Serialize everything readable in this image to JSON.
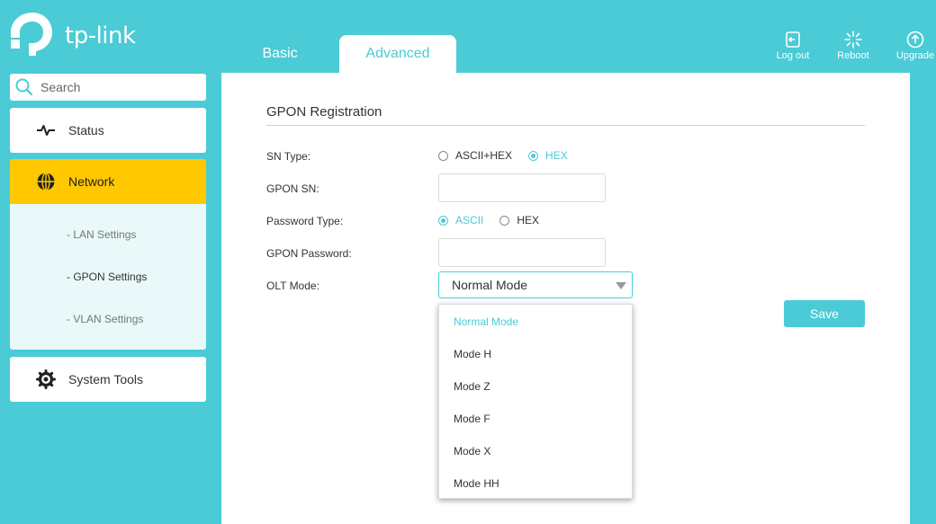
{
  "brand": {
    "name": "tp-link",
    "accent": "#4acbd6",
    "highlight": "#ffc800"
  },
  "tabs": [
    {
      "label": "Basic",
      "active": false
    },
    {
      "label": "Advanced",
      "active": true
    }
  ],
  "header_actions": [
    {
      "label": "Log out",
      "icon": "logout-icon"
    },
    {
      "label": "Reboot",
      "icon": "reboot-icon"
    },
    {
      "label": "Upgrade",
      "icon": "upgrade-icon"
    }
  ],
  "sidebar": {
    "search_placeholder": "Search",
    "items": [
      {
        "label": "Status",
        "icon": "pulse-icon"
      },
      {
        "label": "Network",
        "icon": "globe-icon",
        "active": true
      },
      {
        "label": "System Tools",
        "icon": "gear-icon"
      }
    ],
    "network_sub": [
      {
        "label": "- LAN Settings"
      },
      {
        "label": "- GPON Settings",
        "active": true
      },
      {
        "label": "- VLAN Settings"
      }
    ]
  },
  "form": {
    "title": "GPON Registration",
    "sn_type": {
      "label": "SN Type:",
      "options": [
        "ASCII+HEX",
        "HEX"
      ],
      "selected": "HEX"
    },
    "gpon_sn": {
      "label": "GPON SN:",
      "value": ""
    },
    "password_type": {
      "label": "Password Type:",
      "options": [
        "ASCII",
        "HEX"
      ],
      "selected": "ASCII"
    },
    "gpon_password": {
      "label": "GPON Password:",
      "value": ""
    },
    "olt_mode": {
      "label": "OLT Mode:",
      "value": "Normal Mode",
      "options": [
        "Normal Mode",
        "Mode H",
        "Mode Z",
        "Mode F",
        "Mode X",
        "Mode HH"
      ]
    },
    "save_label": "Save"
  }
}
